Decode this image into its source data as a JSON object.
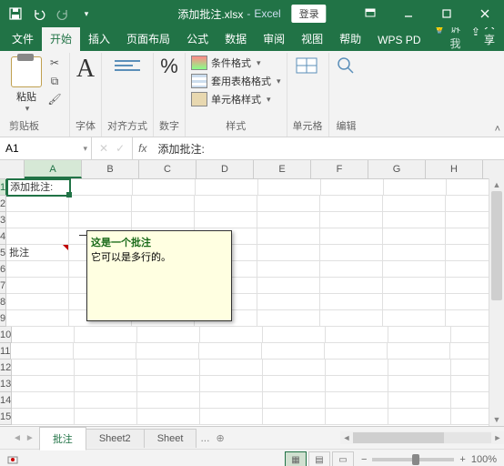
{
  "title": {
    "filename": "添加批注.xlsx",
    "sep": "-",
    "app": "Excel",
    "login": "登录"
  },
  "tabs": {
    "file": "文件",
    "home": "开始",
    "insert": "插入",
    "layout": "页面布局",
    "formulas": "公式",
    "data": "数据",
    "review": "审阅",
    "view": "视图",
    "help": "帮助",
    "wps": "WPS PD",
    "tell": "告诉我",
    "share": "共享"
  },
  "ribbon": {
    "clipboard": "剪贴板",
    "paste": "粘贴",
    "font": "字体",
    "align": "对齐方式",
    "number": "数字",
    "styles": "样式",
    "cond": "条件格式",
    "tablefmt": "套用表格格式",
    "cellstyle": "单元格样式",
    "cells": "单元格",
    "editing": "编辑",
    "pct": "%"
  },
  "namebox": "A1",
  "fx": "fx",
  "formula": "添加批注:",
  "cols": [
    "A",
    "B",
    "C",
    "D",
    "E",
    "F",
    "G",
    "H"
  ],
  "rows": [
    "1",
    "2",
    "3",
    "4",
    "5",
    "6",
    "7",
    "8",
    "9",
    "10",
    "11",
    "12",
    "13",
    "14",
    "15"
  ],
  "cells": {
    "a1": "添加批注:",
    "a5": "批注"
  },
  "comment": {
    "author": "这是一个批注",
    "body": "它可以是多行的。"
  },
  "sheets": {
    "s1": "批注",
    "s2": "Sheet2",
    "s3": "Sheet",
    "dots": "...",
    "add": "⊕"
  },
  "status": {
    "zoom": "100%",
    "minus": "−",
    "plus": "+"
  }
}
